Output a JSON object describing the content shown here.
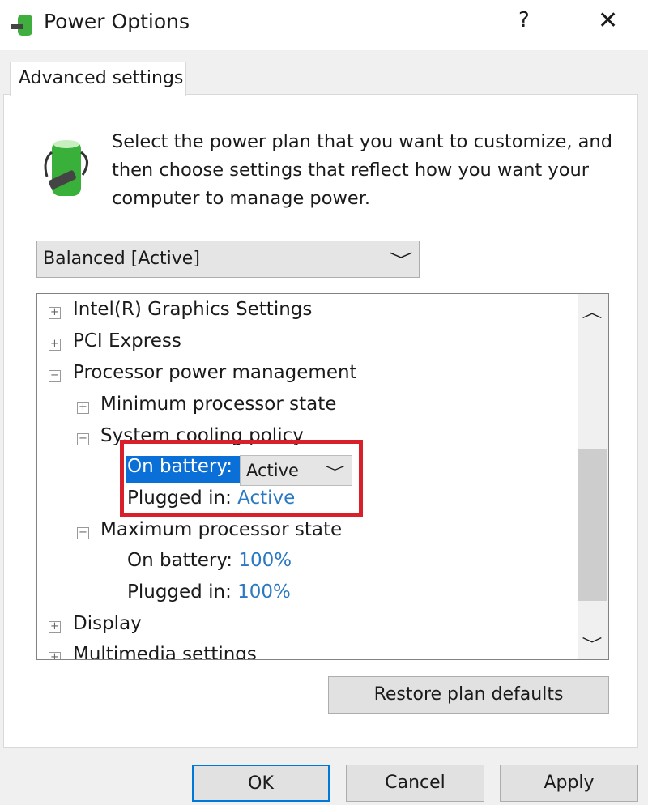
{
  "window": {
    "title": "Power Options",
    "help": "?",
    "close": "✕"
  },
  "tab": "Advanced settings",
  "description": "Select the power plan that you want to customize, and then choose settings that reflect how you want your computer to manage power.",
  "plan_dropdown": {
    "value": "Balanced [Active]"
  },
  "tree": {
    "intel": "Intel(R) Graphics Settings",
    "pci": "PCI Express",
    "processor": "Processor power management",
    "min_state": "Minimum processor state",
    "cooling": "System cooling policy",
    "cooling_battery_label": "On battery:",
    "cooling_battery_value": "Active",
    "cooling_plugged_label": "Plugged in:",
    "cooling_plugged_value": "Active",
    "max_state": "Maximum processor state",
    "max_battery_label": "On battery:",
    "max_battery_value": "100%",
    "max_plugged_label": "Plugged in:",
    "max_plugged_value": "100%",
    "display": "Display",
    "multimedia": "Multimedia settings"
  },
  "buttons": {
    "restore": "Restore plan defaults",
    "ok": "OK",
    "cancel": "Cancel",
    "apply": "Apply"
  },
  "colors": {
    "highlight": "#0a6fd6",
    "annotation": "#d8202a",
    "value": "#2b79c2"
  }
}
